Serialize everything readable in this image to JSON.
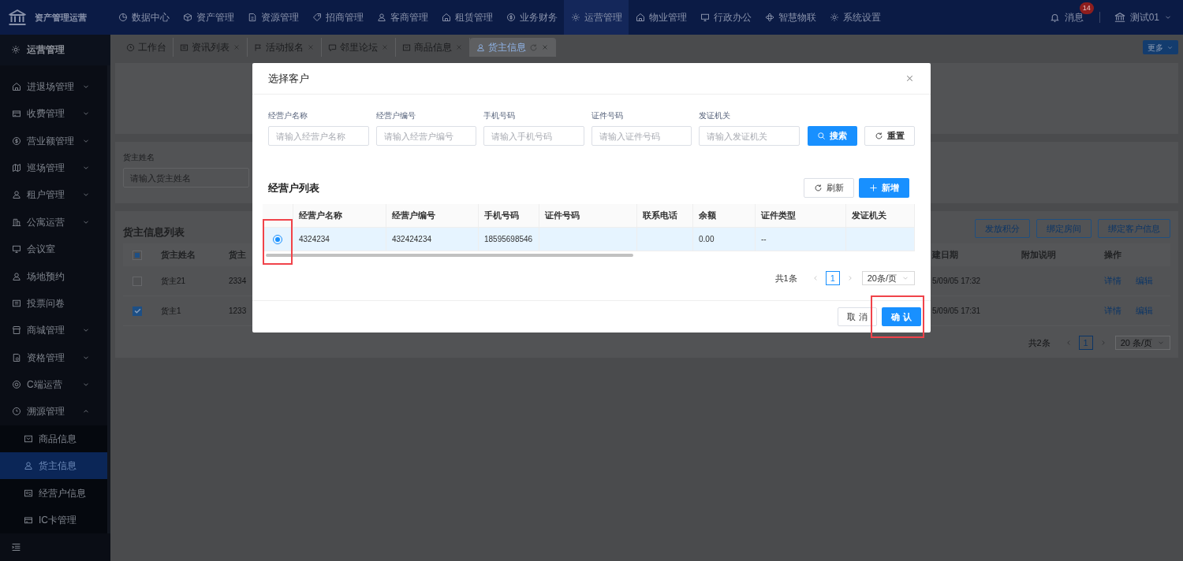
{
  "top_nav": {
    "app_title": "资产管理运营",
    "items": [
      {
        "label": "数据中心",
        "selected": false
      },
      {
        "label": "资产管理",
        "selected": false
      },
      {
        "label": "资源管理",
        "selected": false
      },
      {
        "label": "招商管理",
        "selected": false
      },
      {
        "label": "客商管理",
        "selected": false
      },
      {
        "label": "租赁管理",
        "selected": false
      },
      {
        "label": "业务财务",
        "selected": false
      },
      {
        "label": "运营管理",
        "selected": true
      },
      {
        "label": "物业管理",
        "selected": false
      },
      {
        "label": "行政办公",
        "selected": false
      },
      {
        "label": "智慧物联",
        "selected": false
      },
      {
        "label": "系统设置",
        "selected": false
      }
    ],
    "notifications": {
      "label": "消息",
      "badge": "14"
    },
    "user": "测试01"
  },
  "sidebar": {
    "title": "运营管理",
    "items": [
      {
        "label": "进退场管理",
        "expandable": true,
        "expanded": false
      },
      {
        "label": "收费管理",
        "expandable": true,
        "expanded": false
      },
      {
        "label": "营业额管理",
        "expandable": true,
        "expanded": false
      },
      {
        "label": "巡场管理",
        "expandable": true,
        "expanded": false
      },
      {
        "label": "租户管理",
        "expandable": true,
        "expanded": false
      },
      {
        "label": "公寓运营",
        "expandable": true,
        "expanded": false
      },
      {
        "label": "会议室",
        "expandable": false,
        "expanded": false
      },
      {
        "label": "场地预约",
        "expandable": false,
        "expanded": false
      },
      {
        "label": "投票问卷",
        "expandable": false,
        "expanded": false
      },
      {
        "label": "商城管理",
        "expandable": true,
        "expanded": false
      },
      {
        "label": "资格管理",
        "expandable": true,
        "expanded": false
      },
      {
        "label": "C端运营",
        "expandable": true,
        "expanded": false
      },
      {
        "label": "溯源管理",
        "expandable": true,
        "expanded": true,
        "children": [
          {
            "label": "商品信息",
            "selected": false
          },
          {
            "label": "货主信息",
            "selected": true
          },
          {
            "label": "经营户信息",
            "selected": false
          },
          {
            "label": "IC卡管理",
            "selected": false
          }
        ]
      }
    ]
  },
  "tabs": [
    {
      "label": "工作台",
      "selected": false,
      "closable": false
    },
    {
      "label": "资讯列表",
      "selected": false,
      "closable": true
    },
    {
      "label": "活动报名",
      "selected": false,
      "closable": true
    },
    {
      "label": "邻里论坛",
      "selected": false,
      "closable": true
    },
    {
      "label": "商品信息",
      "selected": false,
      "closable": true
    },
    {
      "label": "货主信息",
      "selected": true,
      "closable": true
    }
  ],
  "more_button": "更多",
  "filter": {
    "label": "货主姓名",
    "placeholder": "请输入货主姓名"
  },
  "owner_list": {
    "title": "货主信息列表",
    "actions": [
      "发放积分",
      "绑定房间",
      "绑定客户信息"
    ],
    "select_all": {
      "checked": false,
      "indeterminate": true
    },
    "columns": [
      "货主姓名",
      "货主",
      "建日期",
      "附加说明",
      "操作"
    ],
    "rows": [
      {
        "checked": false,
        "name": "货主21",
        "column_3": "2334",
        "date": "5/09/05 17:32",
        "actions": [
          "详情",
          "编辑"
        ]
      },
      {
        "checked": true,
        "name": "货主1",
        "column_3": "1233",
        "date": "5/09/05 17:31",
        "actions": [
          "详情",
          "编辑"
        ]
      }
    ],
    "pagination": {
      "total": "共2条",
      "page": "1",
      "page_size": "20 条/页"
    }
  },
  "modal": {
    "title": "选择客户",
    "fields": [
      {
        "label": "经营户名称",
        "placeholder": "请输入经营户名称"
      },
      {
        "label": "经营户编号",
        "placeholder": "请输入经营户编号"
      },
      {
        "label": "手机号码",
        "placeholder": "请输入手机号码"
      },
      {
        "label": "证件号码",
        "placeholder": "请输入证件号码"
      },
      {
        "label": "发证机关",
        "placeholder": "请输入发证机关"
      }
    ],
    "search_button": "搜索",
    "reset_button": "重置",
    "list_title": "经营户列表",
    "refresh_button": "刷新",
    "add_button": "新增",
    "columns": [
      "经营户名称",
      "经营户编号",
      "手机号码",
      "证件号码",
      "联系电话",
      "余额",
      "证件类型",
      "发证机关"
    ],
    "rows": [
      {
        "selected": true,
        "highlighted": true,
        "cells": [
          "4324234",
          "432424234",
          "18595698546",
          null,
          null,
          "0.00",
          "--",
          null
        ]
      }
    ],
    "pagination": {
      "total": "共1条",
      "page": "1",
      "page_size": "20条/页"
    },
    "cancel_button": "取 消",
    "confirm_button": {
      "label": "确 认",
      "highlighted": true
    }
  }
}
